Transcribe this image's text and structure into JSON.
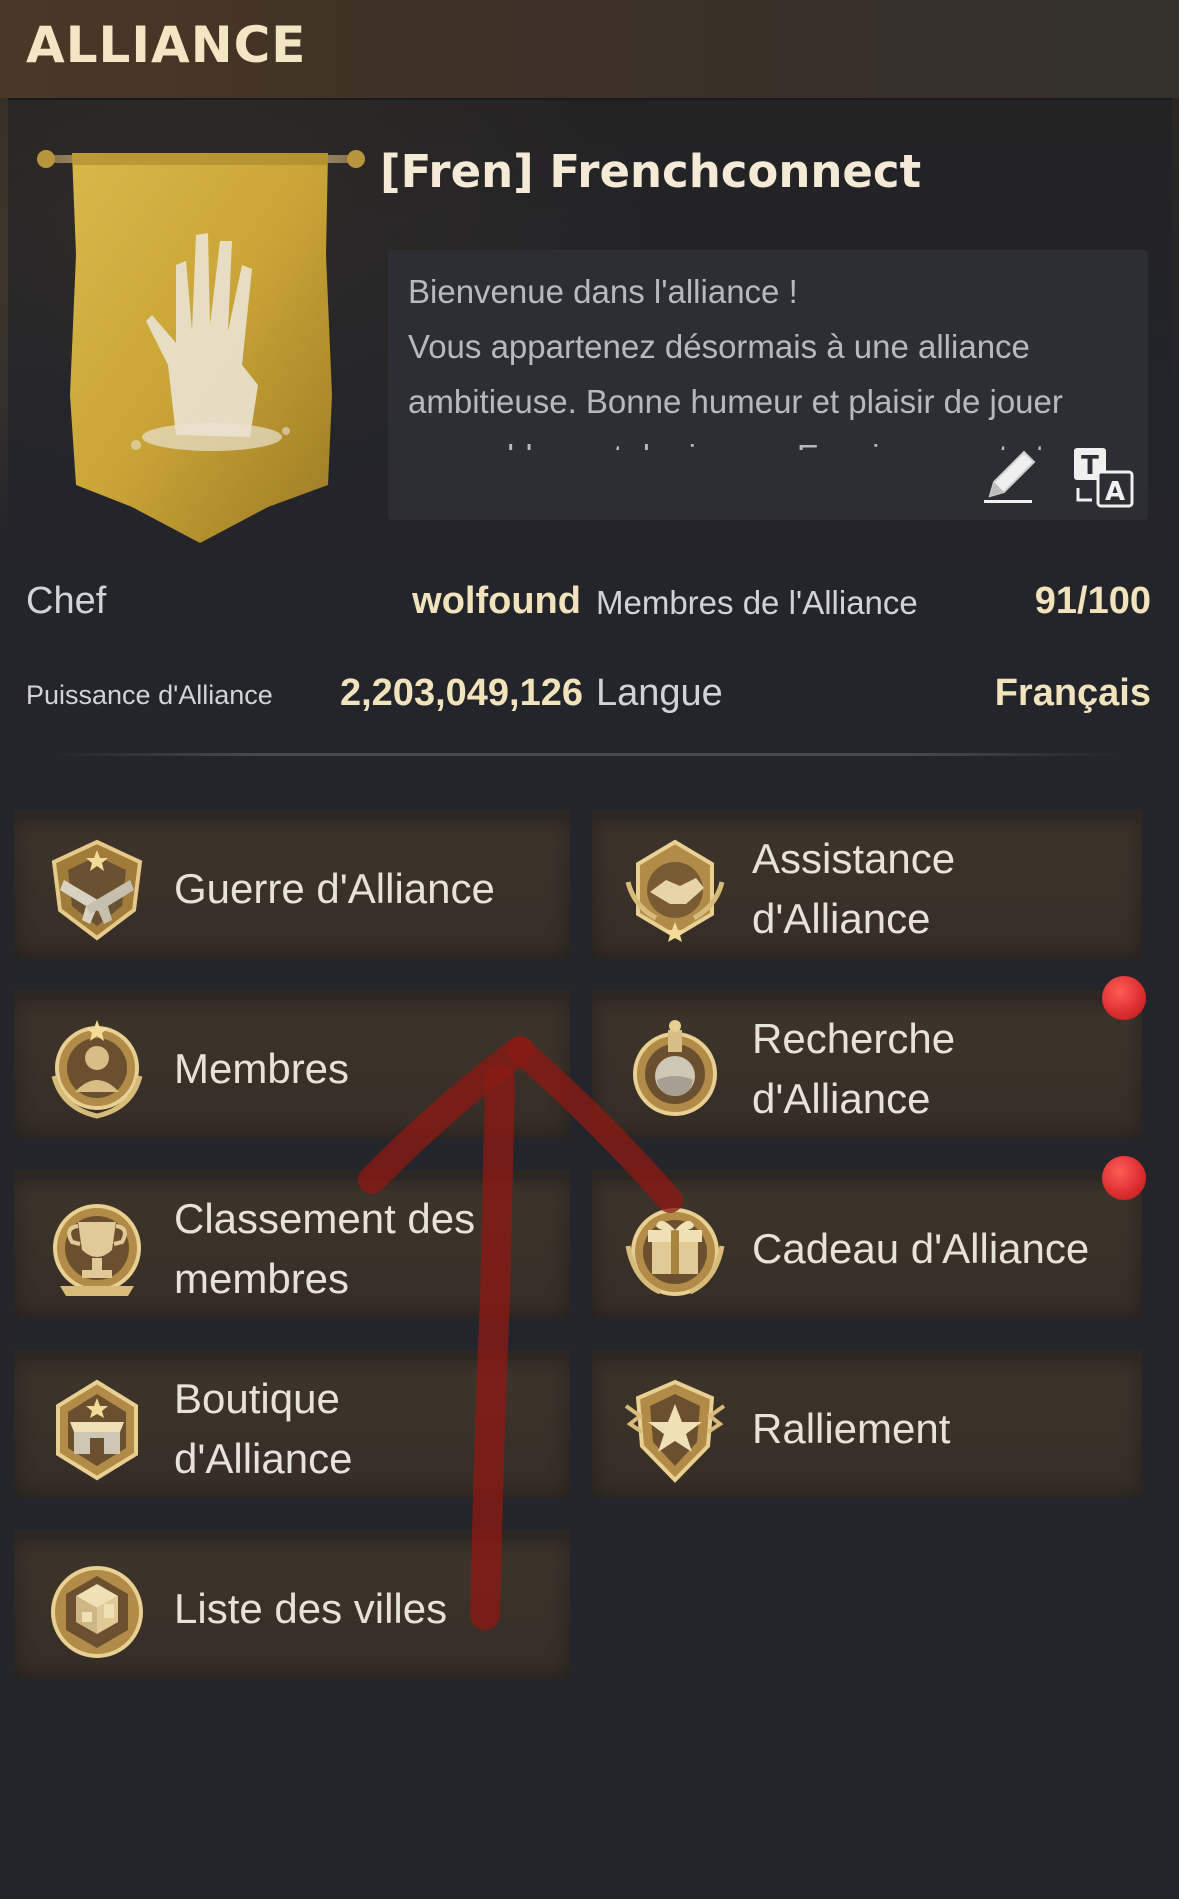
{
  "header": {
    "title": "ALLIANCE"
  },
  "alliance": {
    "name": "[Fren] Frenchconnect",
    "description": "Bienvenue dans l'alliance !\nVous appartenez désormais à une alliance\nambitieuse. Bonne humeur et plaisir de jouer\nensemble sont de rigueur. Enseignement et",
    "banner_icon": "zombie-hand-banner"
  },
  "actions": {
    "edit_icon": "pencil-icon",
    "translate_icon": "translate-icon"
  },
  "info": {
    "chef_label": "Chef",
    "chef_value": "wolfound",
    "members_label": "Membres de l'Alliance",
    "members_value": "91/100",
    "power_label": "Puissance d'Alliance",
    "power_value": "2,203,049,126",
    "language_label": "Langue",
    "language_value": "Français"
  },
  "menu": [
    {
      "label": "Guerre d'Alliance",
      "icon": "crossed-pistols-icon",
      "badge": false
    },
    {
      "label": "Assistance\nd'Alliance",
      "icon": "handshake-icon",
      "badge": false
    },
    {
      "label": "Membres",
      "icon": "member-silhouette-icon",
      "badge": false
    },
    {
      "label": "Recherche\nd'Alliance",
      "icon": "flask-icon",
      "badge": true
    },
    {
      "label": "Classement des\nmembres",
      "icon": "trophy-icon",
      "badge": false
    },
    {
      "label": "Cadeau d'Alliance",
      "icon": "gift-icon",
      "badge": true
    },
    {
      "label": "Boutique\nd'Alliance",
      "icon": "shop-icon",
      "badge": false
    },
    {
      "label": "Ralliement",
      "icon": "star-shield-icon",
      "badge": false
    },
    {
      "label": "Liste des villes",
      "icon": "city-blocks-icon",
      "badge": false
    }
  ],
  "colors": {
    "accent_gold": "#f2e3bd",
    "badge_red": "#d92d2c",
    "annotation_arrow": "#8b1a14"
  }
}
